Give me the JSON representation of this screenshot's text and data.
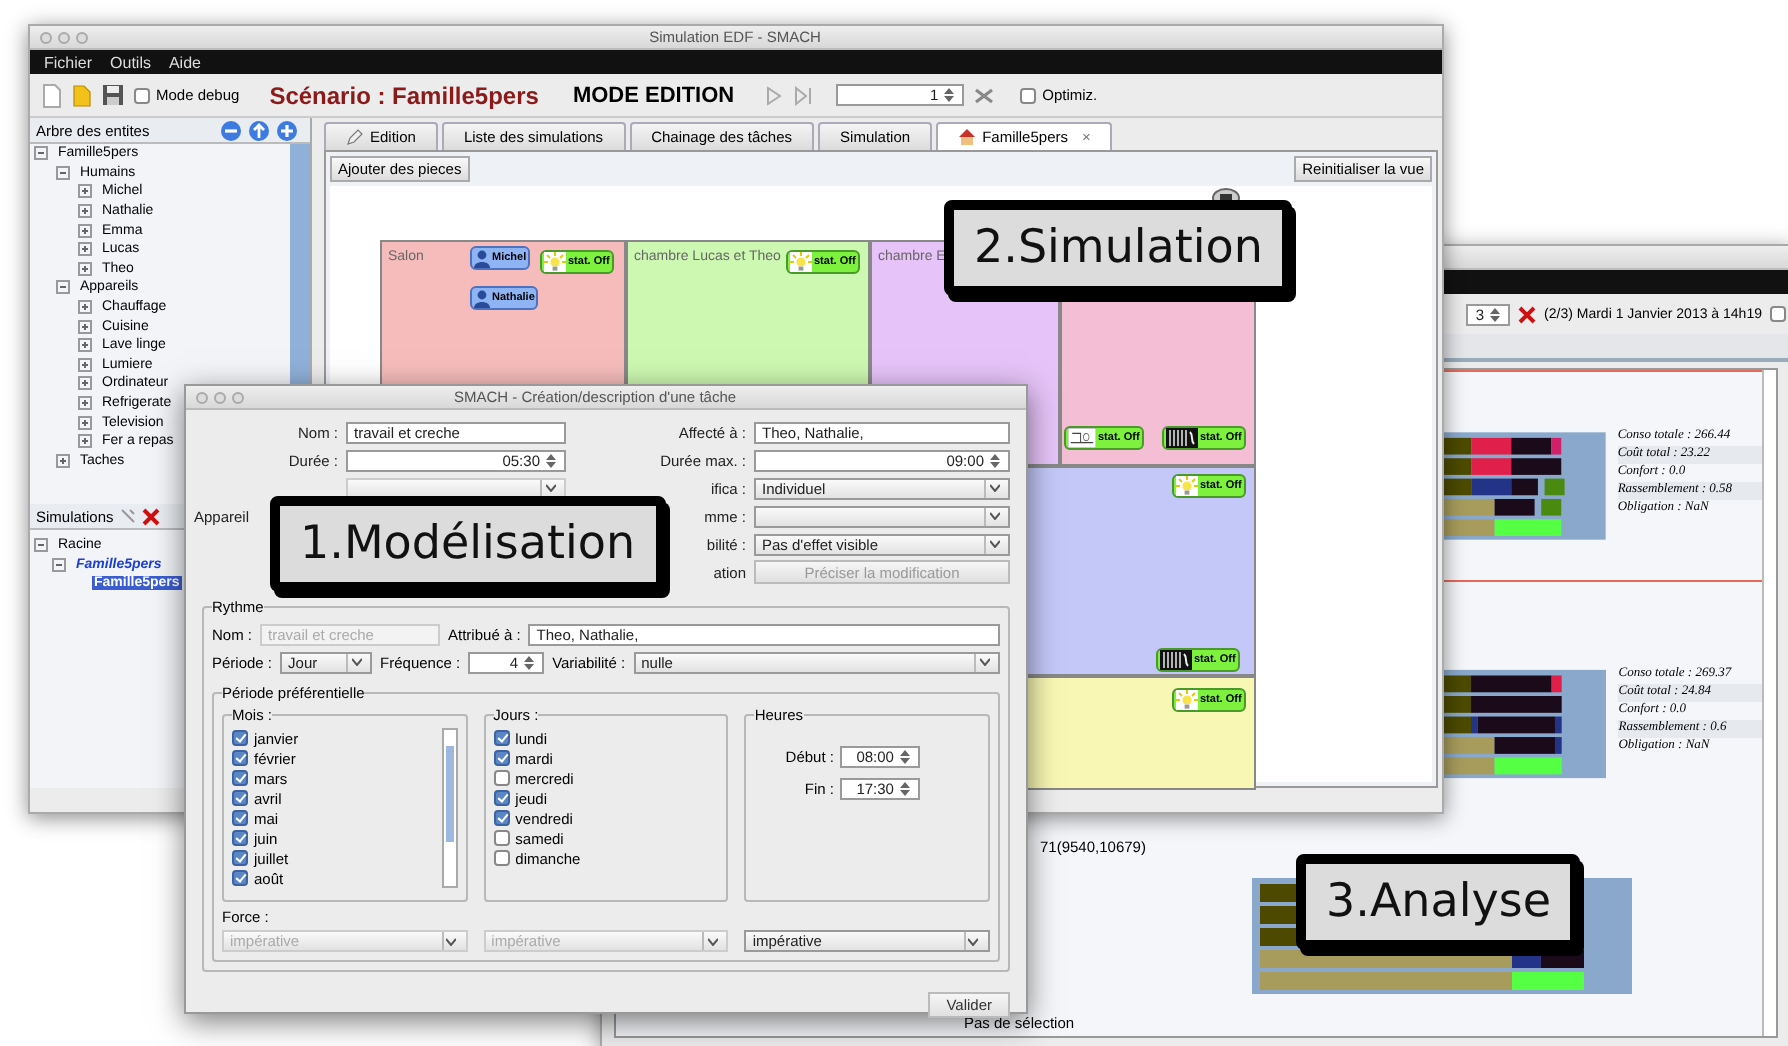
{
  "main_window": {
    "title": "Simulation EDF - SMACH",
    "menu": [
      "Fichier",
      "Outils",
      "Aide"
    ],
    "toolbar": {
      "mode_debug": {
        "label": "Mode debug",
        "checked": false
      },
      "scenario": "Scénario : Famille5pers",
      "mode": "MODE EDITION",
      "step": "1",
      "optimize": {
        "label": "Optimiz.",
        "checked": false
      }
    },
    "entity_tree": {
      "title": "Arbre des entites",
      "items": [
        {
          "label": "Famille5pers",
          "expanded": true,
          "children": [
            {
              "label": "Humains",
              "expanded": true,
              "children": [
                {
                  "label": "Michel",
                  "expanded": false
                },
                {
                  "label": "Nathalie",
                  "expanded": false
                },
                {
                  "label": "Emma",
                  "expanded": false
                },
                {
                  "label": "Lucas",
                  "expanded": false
                },
                {
                  "label": "Theo",
                  "expanded": false
                }
              ]
            },
            {
              "label": "Appareils",
              "expanded": true,
              "children": [
                {
                  "label": "Chauffage",
                  "expanded": false
                },
                {
                  "label": "Cuisine",
                  "expanded": false
                },
                {
                  "label": "Lave linge",
                  "expanded": false
                },
                {
                  "label": "Lumiere",
                  "expanded": false
                },
                {
                  "label": "Ordinateur",
                  "expanded": false
                },
                {
                  "label": "Refrigerate",
                  "expanded": false
                },
                {
                  "label": "Television",
                  "expanded": false
                },
                {
                  "label": "Fer a repas",
                  "expanded": false
                }
              ]
            },
            {
              "label": "Taches",
              "expanded": false
            }
          ]
        }
      ]
    },
    "simulations": {
      "title": "Simulations",
      "items": [
        {
          "label": "Racine",
          "expanded": true,
          "selected": false,
          "children": [
            {
              "label": "Famille5pers",
              "expanded": true,
              "selected": false,
              "children": [
                {
                  "label": "Famille5pers",
                  "selected": true
                }
              ]
            }
          ]
        }
      ]
    },
    "tabs": [
      {
        "label": "Edition",
        "selected": false,
        "kind": "edit"
      },
      {
        "label": "Liste des simulations",
        "selected": false,
        "kind": "plain"
      },
      {
        "label": "Chainage des tâches",
        "selected": false,
        "kind": "plain"
      },
      {
        "label": "Simulation",
        "selected": false,
        "kind": "plain"
      },
      {
        "label": "Famille5pers",
        "selected": true,
        "kind": "house",
        "close": "×"
      }
    ],
    "add_rooms_button": "Ajouter des pieces",
    "reset_view_button": "Reinitialiser la vue",
    "rooms": [
      {
        "name": "Salon",
        "color": "#f6bcbc",
        "people": [
          "Michel",
          "Nathalie"
        ],
        "devices": [
          {
            "kind": "lamp",
            "status": "stat. Off"
          }
        ]
      },
      {
        "name": "chambre Lucas et Theo",
        "color": "#cdf8b2",
        "devices": [
          {
            "kind": "lamp",
            "status": "stat. Off"
          }
        ]
      },
      {
        "name": "chambre E",
        "color": "#e6c3f8"
      },
      {
        "color": "#f4bfd4",
        "devices": [
          {
            "kind": "washer",
            "status": "stat. Off"
          },
          {
            "kind": "radiator",
            "status": "stat. Off"
          }
        ]
      },
      {
        "color": "#c3c8f8",
        "devices": [
          {
            "kind": "lamp",
            "status": "stat. Off"
          },
          {
            "kind": "radiator",
            "status": "stat. Off"
          }
        ]
      },
      {
        "color": "#f8f7b4",
        "devices": [
          {
            "kind": "lamp",
            "status": "stat. Off"
          }
        ]
      }
    ]
  },
  "dialog": {
    "title": "SMACH - Création/description d'une tâche",
    "left_fields": [
      {
        "label": "Nom :",
        "kind": "text",
        "value": "travail et creche"
      },
      {
        "label": "Durée :",
        "kind": "spinner",
        "value": "05:30"
      },
      {
        "kind": "dropdown",
        "disabled": true
      },
      {
        "label": "Appareil",
        "kind": "label"
      }
    ],
    "right_fields": [
      {
        "label": "Affecté à :",
        "kind": "text",
        "value": "Theo, Nathalie,"
      },
      {
        "label": "Durée max. :",
        "kind": "spinner",
        "value": "09:00"
      },
      {
        "label": "ifica :",
        "kind": "dropdown",
        "value": "Individuel"
      },
      {
        "label": "mme :",
        "kind": "dropdown"
      },
      {
        "label": "bilité :",
        "kind": "dropdown",
        "value": "Pas d'effet visible"
      },
      {
        "label": "ation",
        "kind": "button",
        "value": "Préciser la modification",
        "disabled": true
      }
    ],
    "rhythm": {
      "title": "Rythme",
      "name": {
        "label": "Nom :",
        "value": "travail et creche",
        "disabled": true
      },
      "assigned": {
        "label": "Attribué à :",
        "value": "Theo, Nathalie,"
      },
      "period": {
        "label": "Période :",
        "value": "Jour"
      },
      "frequency": {
        "label": "Fréquence :",
        "value": "4"
      },
      "variability": {
        "label": "Variabilité :",
        "value": "nulle"
      },
      "preferred": {
        "title": "Période préférentielle",
        "months": {
          "title": "Mois :",
          "items": [
            {
              "label": "janvier",
              "checked": true
            },
            {
              "label": "février",
              "checked": true
            },
            {
              "label": "mars",
              "checked": true
            },
            {
              "label": "avril",
              "checked": true
            },
            {
              "label": "mai",
              "checked": true
            },
            {
              "label": "juin",
              "checked": true
            },
            {
              "label": "juillet",
              "checked": true
            },
            {
              "label": "août",
              "checked": true
            }
          ]
        },
        "days": {
          "title": "Jours :",
          "items": [
            {
              "label": "lundi",
              "checked": true
            },
            {
              "label": "mardi",
              "checked": true
            },
            {
              "label": "mercredi",
              "checked": false
            },
            {
              "label": "jeudi",
              "checked": true
            },
            {
              "label": "vendredi",
              "checked": true
            },
            {
              "label": "samedi",
              "checked": false
            },
            {
              "label": "dimanche",
              "checked": false
            }
          ]
        },
        "hours": {
          "title": "Heures",
          "start": {
            "label": "Début :",
            "value": "08:00"
          },
          "end": {
            "label": "Fin :",
            "value": "17:30"
          }
        }
      },
      "force": {
        "label": "Force :",
        "selects": [
          {
            "value": "impérative",
            "disabled": true
          },
          {
            "value": "impérative",
            "disabled": true
          },
          {
            "value": "impérative",
            "disabled": false
          }
        ]
      }
    },
    "validate_button": "Valider"
  },
  "analysis_window": {
    "step": "3",
    "status": "(2/3) Mardi 1 Janvier 2013 à 14h19",
    "option_checked": false,
    "results": [
      {
        "highlighted": true,
        "stats": [
          "Conso totale : 266.44",
          "Coût total : 23.22",
          "Confort : 0.0",
          "Rassemblement : 0.58",
          "Obligation : NaN"
        ]
      },
      {
        "highlighted": false,
        "stats": [
          "Conso totale : 269.37",
          "Coût total : 24.84",
          "Confort : 0.0",
          "Rassemblement : 0.6",
          "Obligation : NaN"
        ]
      },
      {
        "highlighted": false,
        "caption": "71(9540,10679)"
      }
    ],
    "footer": "Pas de sélection"
  },
  "callouts": [
    {
      "text": "1.Modélisation"
    },
    {
      "text": "2.Simulation"
    },
    {
      "text": "3.Analyse"
    }
  ]
}
